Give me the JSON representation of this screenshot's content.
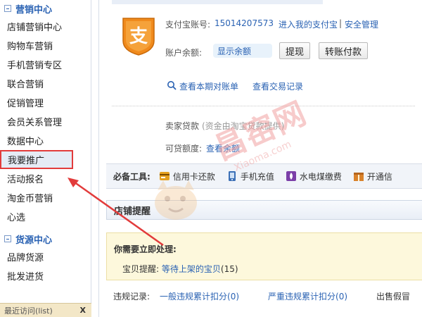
{
  "sidebar": {
    "marketing_title": "营销中心",
    "marketing_items": [
      {
        "label": "店铺营销中心"
      },
      {
        "label": "购物车营销"
      },
      {
        "label": "手机营销专区"
      },
      {
        "label": "联合营销"
      },
      {
        "label": "促销管理"
      },
      {
        "label": "会员关系管理"
      },
      {
        "label": "数据中心"
      },
      {
        "label": "我要推广"
      },
      {
        "label": "活动报名"
      },
      {
        "label": "淘金币营销"
      },
      {
        "label": "心选"
      }
    ],
    "supply_title": "货源中心",
    "supply_items": [
      {
        "label": "品牌货源"
      },
      {
        "label": "批发进货"
      }
    ],
    "recent_text": "最近访问(list)",
    "recent_close": "X"
  },
  "alipay": {
    "account_label": "支付宝账号:",
    "account_value": "15014207573",
    "enter_link": "进入我的支付宝",
    "separator": "|",
    "security_link": "安全管理",
    "balance_label": "账户余额:",
    "balance_button": "显示余额",
    "withdraw_button": "提现",
    "transfer_button": "转账付款",
    "bill_link": "查看本期对账单",
    "records_link": "查看交易记录",
    "loan_label": "卖家贷款",
    "loan_note": "(资金由淘宝贷款提供)",
    "credit_label": "可贷额度:",
    "credit_link": "查看余额"
  },
  "tools": {
    "title": "必备工具:",
    "items": [
      {
        "label": "信用卡还款",
        "icon": "credit-card-icon"
      },
      {
        "label": "手机充值",
        "icon": "phone-icon"
      },
      {
        "label": "水电煤缴费",
        "icon": "utility-icon"
      },
      {
        "label": "开通信",
        "icon": "gift-icon"
      }
    ]
  },
  "shop_notice": {
    "title": "店铺提醒",
    "todo_heading": "你需要立即处理:",
    "reminder_label": "宝贝提醒:",
    "reminder_link": "等待上架的宝贝",
    "reminder_count": "(15)"
  },
  "violations": {
    "label": "违规记录:",
    "general_link": "一般违规累计扣分",
    "general_count": "(0)",
    "severe_link": "严重违规累计扣分",
    "severe_count": "(0)",
    "fake_link": "出售假冒"
  },
  "watermark": {
    "text": "昌窑网",
    "sub": "Xiaoma.com"
  },
  "colors": {
    "link": "#2a62b3",
    "arrow": "#e23b3b",
    "highlight_box": "#e23b3b"
  }
}
